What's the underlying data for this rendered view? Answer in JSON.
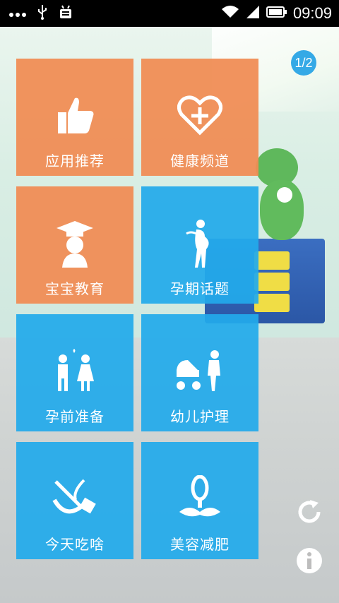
{
  "status_bar": {
    "time": "09:09",
    "icons": [
      "more-dots-icon",
      "usb-icon",
      "android-debug-icon",
      "wifi-icon",
      "signal-icon",
      "battery-icon"
    ]
  },
  "page_indicator": "1/2",
  "tiles": [
    {
      "label": "应用推荐",
      "icon": "thumbs-up-icon",
      "color": "#f08c54"
    },
    {
      "label": "健康频道",
      "icon": "heart-plus-icon",
      "color": "#f08c54"
    },
    {
      "label": "宝宝教育",
      "icon": "graduate-baby-icon",
      "color": "#f08c54"
    },
    {
      "label": "孕期话题",
      "icon": "pregnant-woman-icon",
      "color": "#22aaeb"
    },
    {
      "label": "孕前准备",
      "icon": "couple-icon",
      "color": "#22aaeb"
    },
    {
      "label": "幼儿护理",
      "icon": "stroller-icon",
      "color": "#22aaeb"
    },
    {
      "label": "今天吃啥",
      "icon": "cooking-pot-icon",
      "color": "#22aaeb"
    },
    {
      "label": "美容减肥",
      "icon": "yoga-icon",
      "color": "#22aaeb"
    }
  ],
  "side_buttons": [
    "refresh-icon",
    "info-icon"
  ]
}
